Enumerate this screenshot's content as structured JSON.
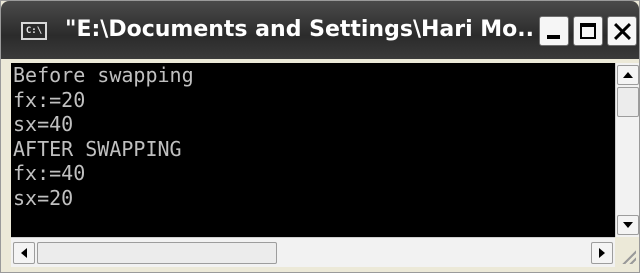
{
  "window": {
    "title": "\"E:\\Documents and Settings\\Hari Mo...",
    "icon_text": "C:\\",
    "icon": "console-icon"
  },
  "titlebar_buttons": {
    "minimize": "minimize-icon",
    "maximize": "maximize-icon",
    "close": "close-icon"
  },
  "console": {
    "background": "#000000",
    "foreground": "#c0c0c0",
    "lines": [
      "Before swapping",
      "fx:=20",
      "sx=40",
      "AFTER SWAPPING",
      "fx:=40",
      "sx=20",
      ""
    ]
  },
  "scrollbars": {
    "vertical": {
      "up": "arrow-up-icon",
      "down": "arrow-down-icon"
    },
    "horizontal": {
      "left": "arrow-left-icon",
      "right": "arrow-right-icon"
    }
  }
}
